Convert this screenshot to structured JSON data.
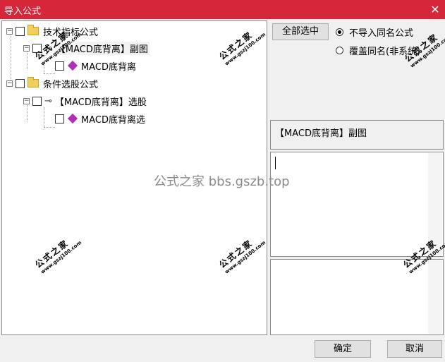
{
  "window": {
    "title": "导入公式",
    "close_glyph": "✕"
  },
  "tree": {
    "nodes": [
      {
        "label": "技术指标公式",
        "type": "folder",
        "expander": "−"
      },
      {
        "label": "【MACD底背离】副图",
        "type": "key",
        "expander": "−"
      },
      {
        "label": "MACD底背离",
        "type": "formula"
      },
      {
        "label": "条件选股公式",
        "type": "folder",
        "expander": "−"
      },
      {
        "label": "【MACD底背离】选股",
        "type": "key",
        "expander": "−"
      },
      {
        "label": "MACD底背离选",
        "type": "formula"
      }
    ],
    "key_glyph": "⊸"
  },
  "options": {
    "select_all_label": "全部选中",
    "radio_no_import": "不导入同名公式",
    "radio_overwrite": "覆盖同名(非系统)",
    "selected_radio": "no_import"
  },
  "detail": {
    "title": "【MACD底背离】副图"
  },
  "watermark": {
    "big": "公式之家",
    "small": "www.gszj100.com",
    "center": "公式之家 bbs.gszb.top"
  },
  "buttons": {
    "ok": "确定",
    "cancel": "取消"
  },
  "colors": {
    "titlebar": "#d5263a",
    "formula_icon": "#b02fb8",
    "folder": "#f2cf5b"
  }
}
